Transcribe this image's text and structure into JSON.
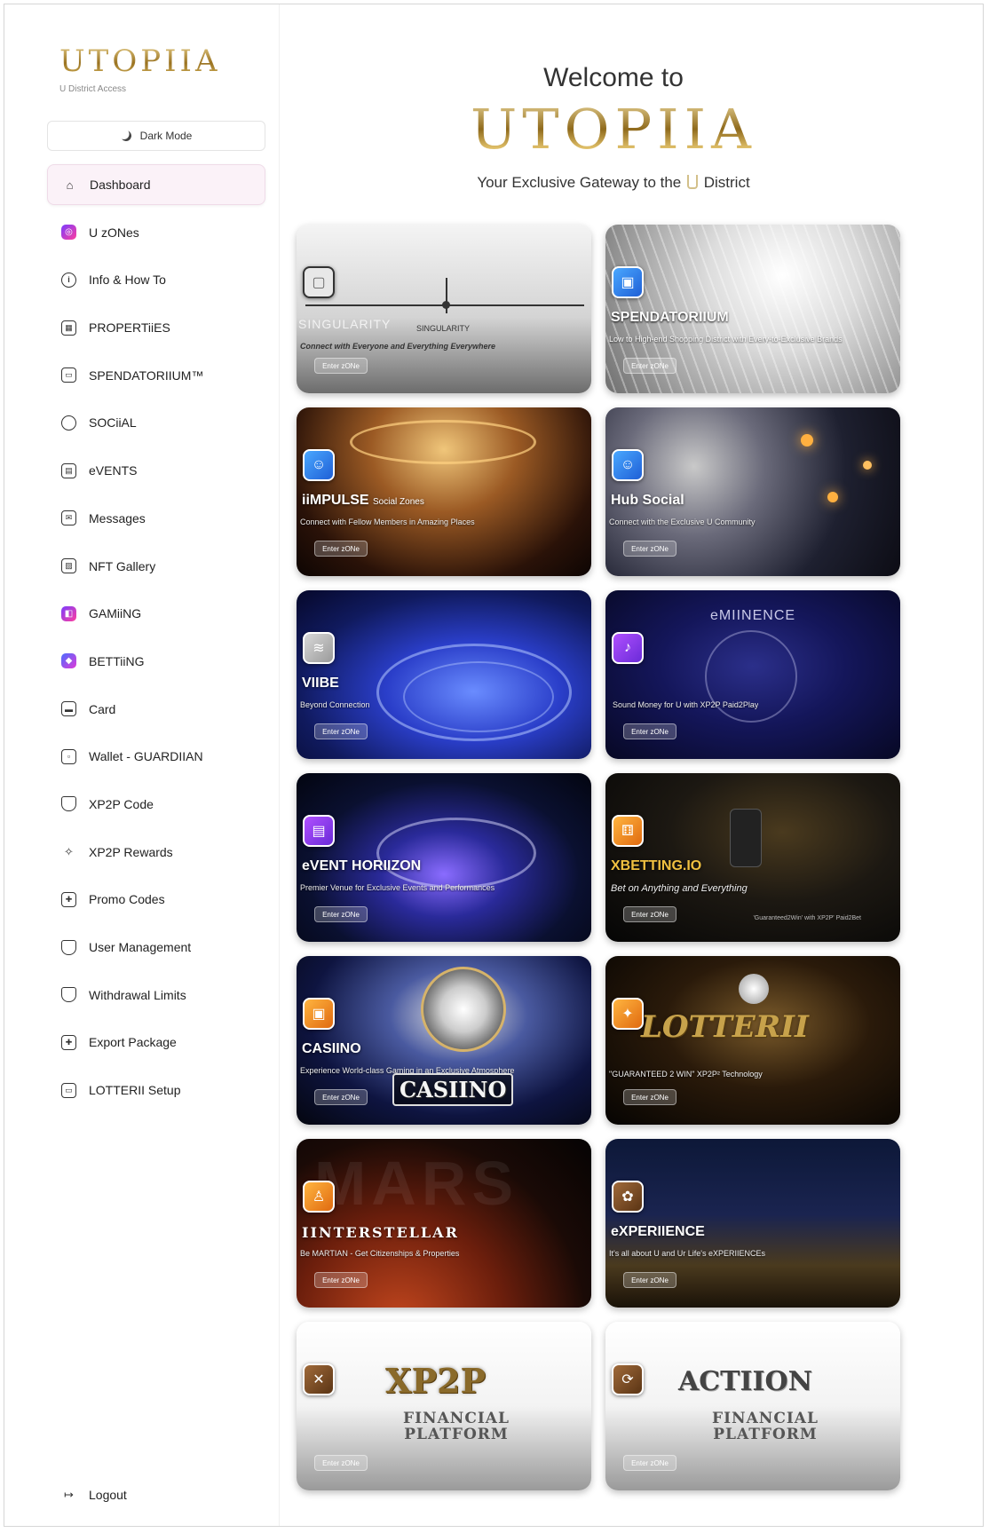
{
  "sidebar": {
    "logo": "UTOPIIA",
    "subtitle": "U District Access",
    "dark_mode_label": "Dark Mode",
    "items": [
      {
        "label": "Dashboard",
        "icon": "home-icon"
      },
      {
        "label": "U zONes",
        "icon": "zones-icon"
      },
      {
        "label": "Info & How To",
        "icon": "info-icon"
      },
      {
        "label": "PROPERTiiES",
        "icon": "building-icon"
      },
      {
        "label": "SPENDATORIIUM™",
        "icon": "store-icon"
      },
      {
        "label": "SOCiiAL",
        "icon": "chat-bubble-icon"
      },
      {
        "label": "eVENTS",
        "icon": "calendar-icon"
      },
      {
        "label": "Messages",
        "icon": "mail-icon"
      },
      {
        "label": "NFT Gallery",
        "icon": "image-icon"
      },
      {
        "label": "GAMiiNG",
        "icon": "gamepad-icon"
      },
      {
        "label": "BETTiiNG",
        "icon": "betting-icon"
      },
      {
        "label": "Card",
        "icon": "credit-card-icon"
      },
      {
        "label": "Wallet - GUARDIIAN",
        "icon": "wallet-icon"
      },
      {
        "label": "XP2P Code",
        "icon": "shield-icon"
      },
      {
        "label": "XP2P Rewards",
        "icon": "sparkles-icon"
      },
      {
        "label": "Promo Codes",
        "icon": "gift-icon"
      },
      {
        "label": "User Management",
        "icon": "shield-icon"
      },
      {
        "label": "Withdrawal Limits",
        "icon": "shield-icon"
      },
      {
        "label": "Export Package",
        "icon": "gift-icon"
      },
      {
        "label": "LOTTERII Setup",
        "icon": "ticket-icon"
      }
    ],
    "logout_label": "Logout"
  },
  "header": {
    "welcome": "Welcome to",
    "logo": "UTOPIIA",
    "tagline_before": "Your Exclusive Gateway to the",
    "tagline_after": "District"
  },
  "cards": [
    {
      "title": "",
      "ghost": "SINGULARITY",
      "label": "SINGULARITY",
      "desc": "Connect with Everyone and Everything Everywhere",
      "button": "Enter zONe"
    },
    {
      "title": "SPENDATORIIUM",
      "desc": "Low to High-end Shopping District with Every-to-Exclusive Brands",
      "button": "Enter zONe"
    },
    {
      "title": "iiMPULSE",
      "title_small": "Social Zones",
      "desc": "Connect with Fellow Members in Amazing Places",
      "button": "Enter zONe"
    },
    {
      "title": "Hub Social",
      "desc": "Connect with the Exclusive U Community",
      "button": "Enter zONe"
    },
    {
      "title": "VIIBE",
      "desc": "Beyond Connection",
      "button": "Enter zONe"
    },
    {
      "title": "",
      "top_title": "eMIINENCE",
      "desc": "Sound Money for U with XP2P Paid2Play",
      "button": "Enter zONe"
    },
    {
      "title": "eVENT HORIIZON",
      "desc": "Premier Venue for Exclusive Events and Performances",
      "button": "Enter zONe"
    },
    {
      "title": "XBETTING.IO",
      "desc": "Bet on Anything and Everything",
      "button": "Enter zONe",
      "extra": "'Guaranteed2Win' with XP2P' Paid2Bet"
    },
    {
      "title": "CASIINO",
      "desc": "Experience World-class Gaming in an Exclusive Atmosphere",
      "button": "Enter zONe",
      "wordmark": "CASIINO"
    },
    {
      "title": "",
      "wordmark": "LOTTERII",
      "desc": "\"GUARANTEED 2 WIN\" XP2P² Technology",
      "button": "Enter zONe"
    },
    {
      "title": "IINTERSTELLAR",
      "bg_word": "MARS",
      "desc": "Be MARTIAN - Get Citizenships & Properties",
      "button": "Enter zONe"
    },
    {
      "title": "eXPERIIENCE",
      "desc": "It's all about U and Ur Life's eXPERIIENCEs",
      "button": "Enter zONe"
    },
    {
      "title": "",
      "wordmark": "XP2P",
      "fin1": "FINANCIAL",
      "fin2": "PLATFORM",
      "button": "Enter zONe"
    },
    {
      "title": "",
      "wordmark": "ACTIION",
      "fin1": "FINANCIAL",
      "fin2": "PLATFORM",
      "button": "Enter zONe"
    }
  ],
  "colors": {
    "gold": "#b8963f",
    "active_bg": "#fbf2f8"
  }
}
